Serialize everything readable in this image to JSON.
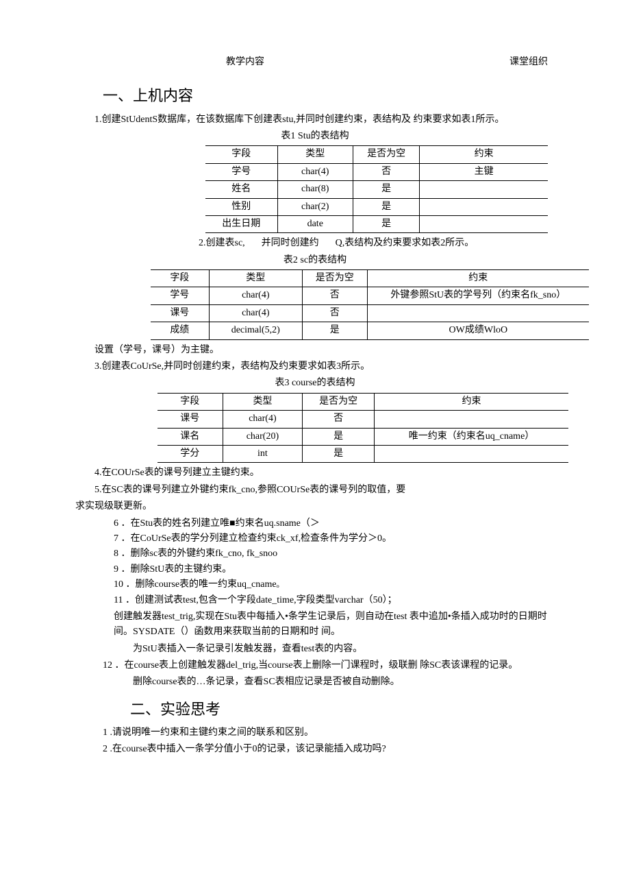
{
  "header": {
    "left": "教学内容",
    "right": "课堂组织"
  },
  "section1": {
    "title": "一、上机内容",
    "p1": "1.创建StUdentS数据库，在该数据库下创建表stu,并同时创建约束，表结构及 约束要求如表1所示。",
    "cap1": "表1 Stu的表结构",
    "t1": {
      "h": [
        "字段",
        "类型",
        "是否为空",
        "约束"
      ],
      "r": [
        [
          "学号",
          "char(4)",
          "否",
          "主键"
        ],
        [
          "姓名",
          "char(8)",
          "是",
          ""
        ],
        [
          "性别",
          "char(2)",
          "是",
          ""
        ],
        [
          "出生日期",
          "date",
          "是",
          ""
        ]
      ]
    },
    "p2a": "2.创建表sc,",
    "p2b": "并同时创建约",
    "p2c": "Q,表结构及约束要求如表2所示。",
    "cap2": "表2 sc的表结构",
    "t2": {
      "h": [
        "字段",
        "类型",
        "是否为空",
        "约束"
      ],
      "r": [
        [
          "学号",
          "char(4)",
          "否",
          "外键参照StU表的学号列（约束名fk_sno）"
        ],
        [
          "课号",
          "char(4)",
          "否",
          ""
        ],
        [
          "成绩",
          "decimal(5,2)",
          "是",
          "OW成绩WloO"
        ]
      ]
    },
    "p2d": "设置（学号，课号）为主键。",
    "p3": "3.创建表CoUrSe,并同时创建约束，表结构及约束要求如表3所示。",
    "cap3": "表3 course的表结构",
    "t3": {
      "h": [
        "字段",
        "类型",
        "是否为空",
        "约束"
      ],
      "r": [
        [
          "课号",
          "char(4)",
          "否",
          ""
        ],
        [
          "课名",
          "char(20)",
          "是",
          "唯一约束（约束名uq_cname）"
        ],
        [
          "学分",
          "int",
          "是",
          ""
        ]
      ]
    },
    "p4": "4.在COUrSe表的课号列建立主键约束。",
    "p5a": "5.在SC表的课号列建立外键约束fk_cno,参照COUrSe表的课号列的取值，要",
    "p5b": "求实现级联更新。",
    "items": [
      "6 ．在Stu表的姓名列建立唯■约束名uq.sname（＞",
      "7 ．在CoUrSe表的学分列建立检查约束ck_xf,检查条件为学分＞0。",
      "8 ．删除sc表的外键约束fk_cno, fk_snoo",
      "9 ．删除StU表的主键约束。",
      "10 ．删除course表的唯一约束uq_cnameₒ",
      "11 ．创建测试表test,包含一个字段date_time,字段类型varchar（50）；"
    ],
    "p11a": "创建触发器test_trig,实现在Stu表中每插入•条学生记录后，则自动在test 表中追加•条插入成功时的日期时间。SYSDATE（）函数用来获取当前的日期和时 间。",
    "p11b": "为StU表插入一条记录引发触发器，查看test表的内容。",
    "p12a": "12 ．在course表上创建触发器del_trig,当course表上删除一门课程时，级联删 除SC表该课程的记录。",
    "p12b": "删除course表的…条记录，查看SC表相应记录是否被自动删除。"
  },
  "section2": {
    "title": "二、实验思考",
    "q1": "1 .请说明唯一约束和主键约束之间的联系和区别。",
    "q2": "2 .在course表中插入一条学分值小于0的记录，该记录能插入成功吗?"
  }
}
